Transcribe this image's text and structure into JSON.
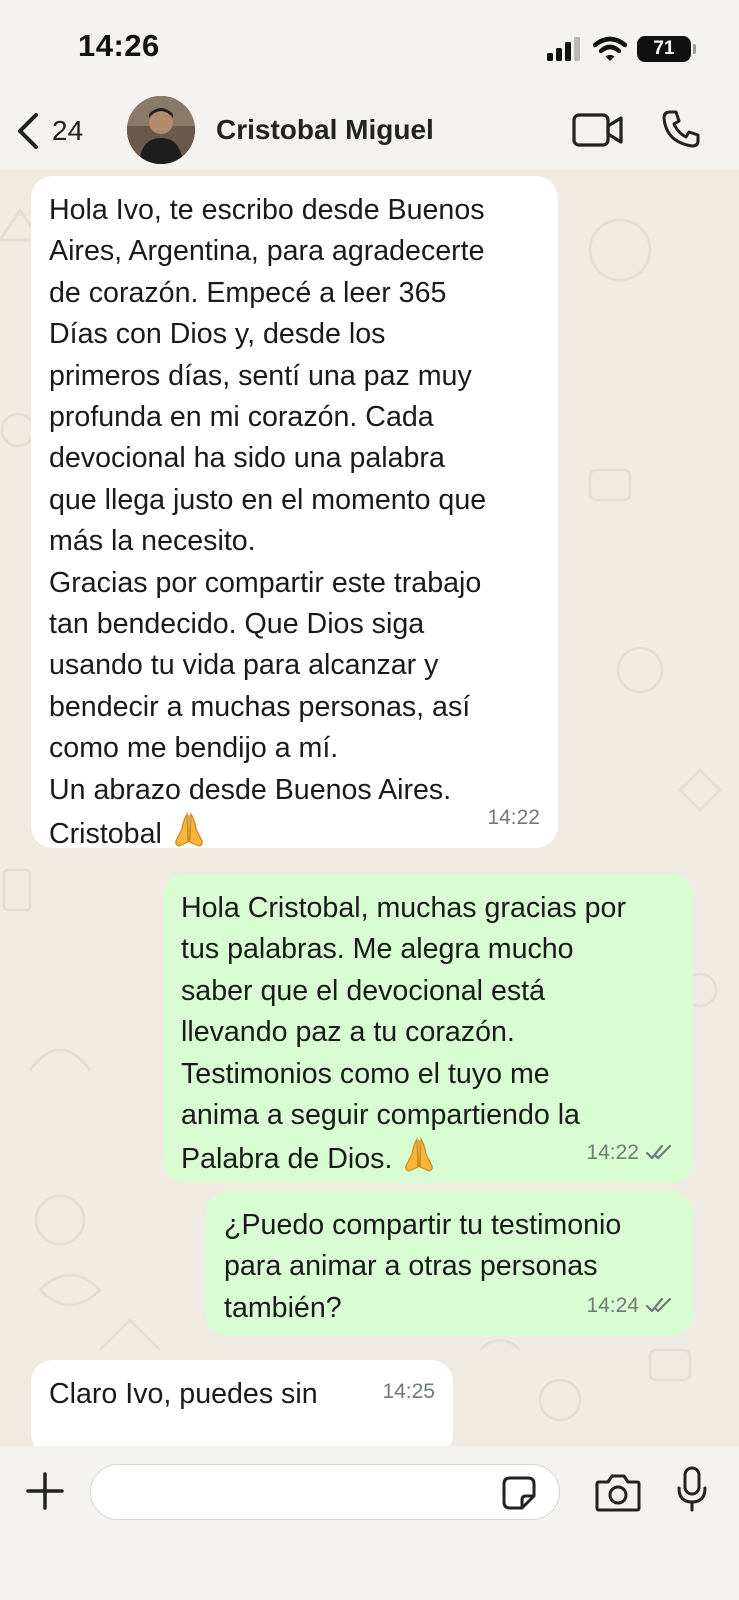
{
  "status_bar": {
    "time": "14:26",
    "battery": "71"
  },
  "header": {
    "back_count": "24",
    "contact_name": "Cristobal Miguel"
  },
  "messages": [
    {
      "direction": "incoming",
      "text": "Hola Ivo, te escribo desde Buenos\nAires, Argentina, para agradecerte\nde corazón. Empecé a leer 365\nDías con Dios y, desde los\nprimeros días, sentí una paz muy\nprofunda en mi corazón. Cada\ndevocional ha sido una palabra\nque llega justo en el momento que\nmás la necesito.\nGracias por compartir este trabajo\ntan bendecido. Que Dios siga\nusando tu vida para alcanzar y\nbendecir a muchas personas, así\ncomo me bendijo a mí.\nUn abrazo desde Buenos Aires.\nCristobal",
      "emoji": "praying-hands",
      "time": "14:22"
    },
    {
      "direction": "outgoing",
      "text": "Hola Cristobal, muchas gracias por\ntus palabras. Me alegra mucho\nsaber que el devocional está\nllevando paz a tu corazón.\nTestimonios como el tuyo me\nanima a seguir compartiendo la\nPalabra de Dios.",
      "emoji": "praying-hands",
      "time": "14:22",
      "status": "read"
    },
    {
      "direction": "outgoing",
      "text": "¿Puedo compartir tu testimonio\npara animar a otras personas\ntambién?",
      "time": "14:24",
      "status": "read"
    },
    {
      "direction": "incoming",
      "text": "Claro Ivo, puedes sin",
      "time": "14:25"
    }
  ],
  "composer": {
    "placeholder": ""
  },
  "icons": {
    "back": "chevron-left-icon",
    "video": "video-camera-icon",
    "call": "phone-icon",
    "plus": "plus-icon",
    "sticker": "sticker-icon",
    "camera": "camera-icon",
    "mic": "microphone-icon",
    "read_receipt": "double-check-icon"
  },
  "colors": {
    "incoming_bubble": "#ffffff",
    "outgoing_bubble": "#d8fdd2",
    "chat_background": "#efeae2",
    "bar_background": "#f4f2ef",
    "read_receipt": "#6f7b75"
  }
}
